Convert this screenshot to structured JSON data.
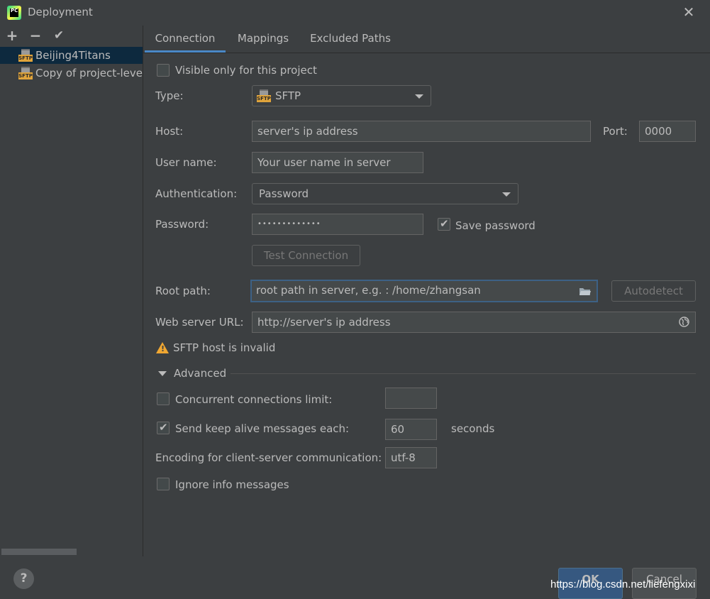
{
  "window": {
    "title": "Deployment",
    "app_icon_text": "PC"
  },
  "left": {
    "toolbar": {
      "add": "+",
      "remove": "−",
      "apply": "✔"
    },
    "servers": [
      {
        "label": "Beijing4Titans",
        "selected": true,
        "icon": "sftp-server-icon"
      },
      {
        "label": "Copy of project-leve",
        "selected": false,
        "icon": "sftp-server-icon"
      }
    ],
    "icon_badge": "SFTP"
  },
  "tabs": [
    {
      "label": "Connection",
      "active": true
    },
    {
      "label": "Mappings",
      "active": false
    },
    {
      "label": "Excluded Paths",
      "active": false
    }
  ],
  "form": {
    "visible_only": {
      "label": "Visible only for this project",
      "checked": false
    },
    "type": {
      "label": "Type:",
      "value": "SFTP"
    },
    "host": {
      "label": "Host:",
      "value": "server's ip address"
    },
    "port": {
      "label": "Port:",
      "value": "0000"
    },
    "username": {
      "label": "User name:",
      "value": "Your user name in server"
    },
    "auth": {
      "label": "Authentication:",
      "value": "Password"
    },
    "password": {
      "label": "Password:",
      "value": "•••••••••••••"
    },
    "save_password": {
      "label": "Save password",
      "checked": true
    },
    "test_connection": "Test Connection",
    "root_path": {
      "label": "Root path:",
      "value": "root path in server, e.g. : /home/zhangsan"
    },
    "autodetect": "Autodetect",
    "web_url": {
      "label": "Web server URL:",
      "value": "http://server's ip address"
    },
    "warning": "SFTP host is invalid",
    "advanced": "Advanced",
    "concurrent": {
      "label": "Concurrent connections limit:",
      "checked": false,
      "value": ""
    },
    "keepalive": {
      "label": "Send keep alive messages each:",
      "checked": true,
      "value": "60",
      "unit": "seconds"
    },
    "encoding": {
      "label": "Encoding for client-server communication:",
      "value": "utf-8"
    },
    "ignore_info": {
      "label": "Ignore info messages",
      "checked": false
    }
  },
  "footer": {
    "help": "?",
    "ok": "OK",
    "cancel": "Cancel",
    "watermark": "https://blog.csdn.net/liefengxixi"
  },
  "colors": {
    "accent": "#4a88c7",
    "selection": "#0d293e",
    "warning": "#f0a732",
    "ok_button": "#365880"
  }
}
